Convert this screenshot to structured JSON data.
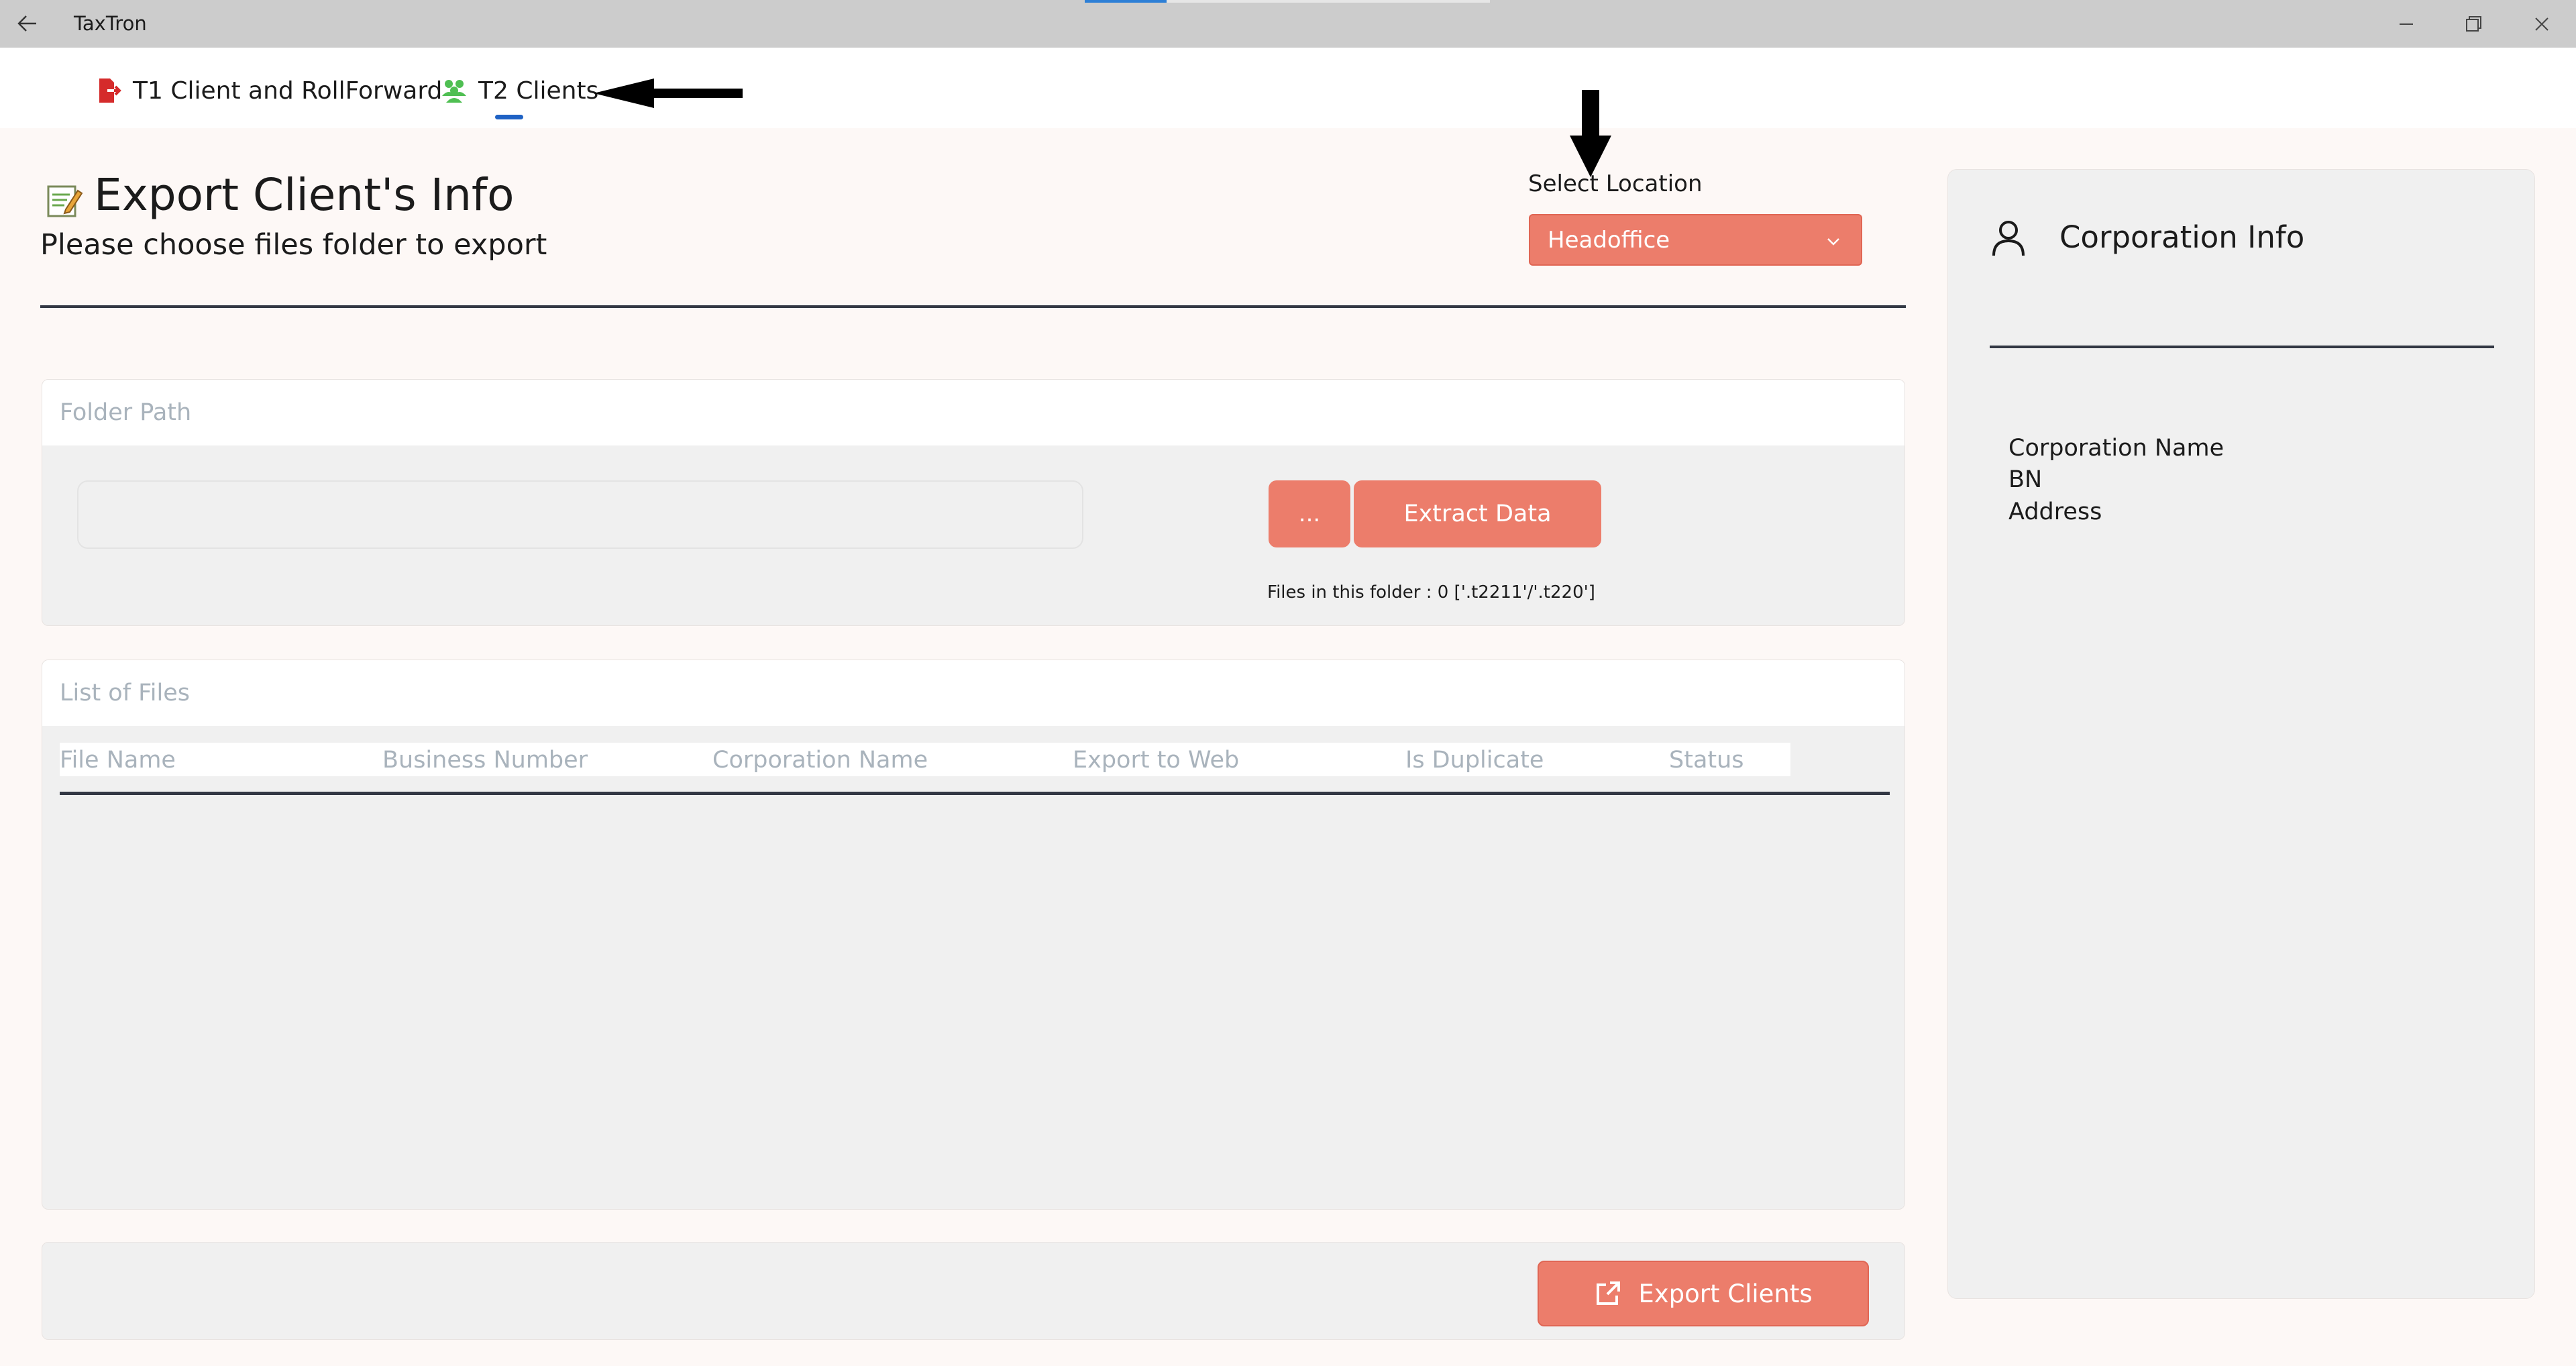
{
  "window": {
    "title": "TaxTron",
    "back_icon": "back-arrow-icon",
    "controls": [
      "minimize-icon",
      "maximize-icon",
      "close-icon"
    ]
  },
  "nav": {
    "items": [
      {
        "label": "T1 Client and RollForward",
        "icon": "export-file-icon",
        "icon_color": "#d52b2b"
      },
      {
        "label": "T2 Clients",
        "icon": "people-icon",
        "icon_color": "#4fbf52",
        "selected": true
      }
    ],
    "accent": "#1f62c4"
  },
  "header": {
    "title": "Export Client's Info",
    "subtitle": "Please choose files folder to export",
    "icon": "edit-document-icon"
  },
  "location": {
    "label": "Select Location",
    "selected": "Headoffice"
  },
  "folder_card": {
    "heading": "Folder Path",
    "path_value": "",
    "browse_label": "...",
    "extract_label": "Extract Data",
    "files_count_text": "Files in this folder : 0 ['.t2211'/'.t220']"
  },
  "files_card": {
    "heading": "List of Files",
    "columns": [
      "File Name",
      "Business Number",
      "Corporation Name",
      "Export to Web",
      "Is Duplicate",
      "Status"
    ],
    "rows": []
  },
  "footer": {
    "export_label": "Export Clients",
    "export_icon": "external-link-icon"
  },
  "side_panel": {
    "title": "Corporation Info",
    "icon": "person-icon",
    "fields": [
      "Corporation Name",
      "BN",
      "Address"
    ]
  },
  "colors": {
    "accent_button": "#ec7d6b",
    "page_bg": "#fdf8f6",
    "card_bg": "#f0f0f0",
    "muted_text": "#a9b3bc",
    "rule": "#333844"
  }
}
